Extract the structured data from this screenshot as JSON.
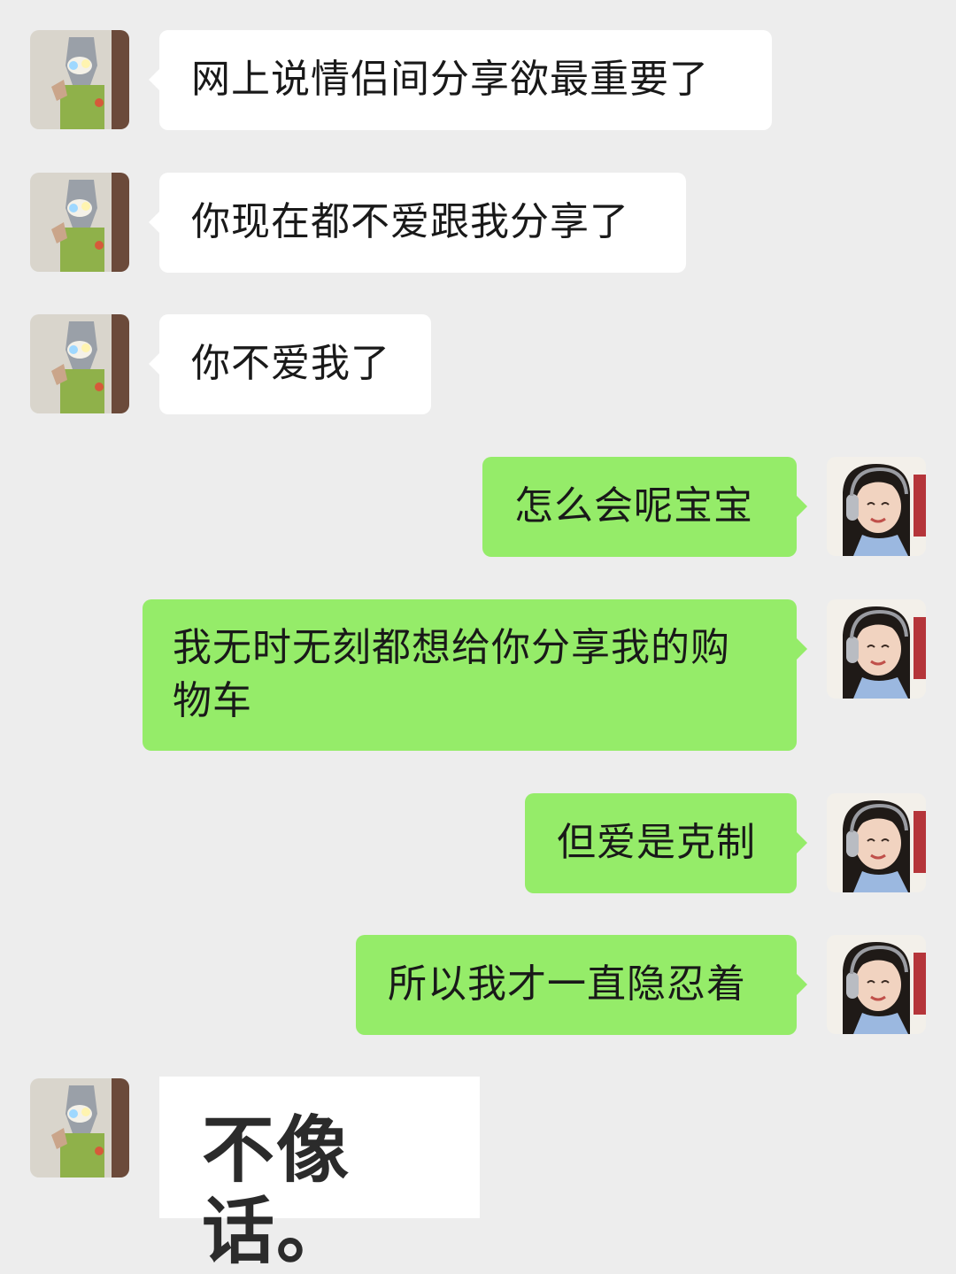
{
  "chat": {
    "messages": [
      {
        "side": "left",
        "text": "网上说情侣间分享欲最重要了"
      },
      {
        "side": "left",
        "text": "你现在都不爱跟我分享了"
      },
      {
        "side": "left",
        "text": "你不爱我了"
      },
      {
        "side": "right",
        "text": "怎么会呢宝宝"
      },
      {
        "side": "right",
        "text": "我无时无刻都想给你分享我的购\n物车"
      },
      {
        "side": "right",
        "text": "但爱是克制"
      },
      {
        "side": "right",
        "text": "所以我才一直隐忍着"
      },
      {
        "side": "left",
        "text": "不像话。",
        "kind": "sticker"
      }
    ]
  },
  "avatars": {
    "left": {
      "icon": "ultraman-avatar-icon"
    },
    "right": {
      "icon": "girl-headphones-avatar-icon"
    }
  },
  "colors": {
    "background": "#ededed",
    "incoming_bubble": "#ffffff",
    "outgoing_bubble": "#95ec69",
    "text": "#191919"
  }
}
